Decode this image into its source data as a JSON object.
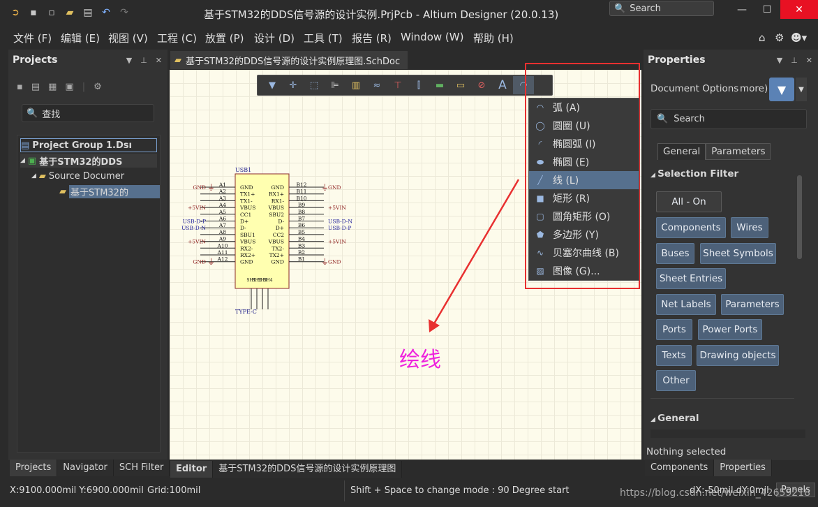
{
  "app": {
    "title": "基于STM32的DDS信号源的设计实例.PrjPcb - Altium Designer (20.0.13)",
    "search_label": "Search"
  },
  "menu": [
    "文件 (F)",
    "编辑 (E)",
    "视图 (V)",
    "工程 (C)",
    "放置 (P)",
    "设计 (D)",
    "工具 (T)",
    "报告 (R)",
    "Window (W)",
    "帮助 (H)"
  ],
  "projects_panel": {
    "title": "Projects",
    "search_placeholder": "查找",
    "tree": {
      "group": "Project Group 1.Dsı",
      "project": "基于STM32的DDS",
      "folder": "Source Documer",
      "doc": "基于STM32的"
    },
    "tabs": [
      "Projects",
      "Navigator",
      "SCH Filter"
    ]
  },
  "document": {
    "tab_label": "基于STM32的DDS信号源的设计实例原理图.SchDoc",
    "bottom_tabs": [
      "Editor",
      "基于STM32的DDS信号源的设计实例原理图"
    ]
  },
  "schematic": {
    "designator": "USB1",
    "footprint": "TYPE-C",
    "left_nets": [
      "GND",
      "+5VIN",
      "USB-D-P",
      "USB-D-N",
      "+5VIN",
      "GND"
    ],
    "left_pins": [
      "A1",
      "A2",
      "A3",
      "A4",
      "A5",
      "A6",
      "A7",
      "A8",
      "A9",
      "A10",
      "A11",
      "A12"
    ],
    "left_names": [
      "GND",
      "TX1+",
      "TX1-",
      "VBUS",
      "CC1",
      "D+",
      "D-",
      "SBU1",
      "VBUS",
      "RX2-",
      "RX2+",
      "GND"
    ],
    "right_pins": [
      "B12",
      "B11",
      "B10",
      "B9",
      "B8",
      "B7",
      "B6",
      "B5",
      "B4",
      "B3",
      "B2",
      "B1"
    ],
    "right_names": [
      "GND",
      "RX1+",
      "RX1-",
      "VBUS",
      "SBU2",
      "D-",
      "D+",
      "CC2",
      "VBUS",
      "TX2-",
      "TX2+",
      "GND"
    ],
    "right_nets": [
      "GND",
      "+5VIN",
      "USB-D-N",
      "USB-D-P",
      "+5VIN",
      "GND"
    ],
    "bottom_names": [
      "SH1",
      "SH2",
      "SH3",
      "SH4"
    ]
  },
  "dropdown": {
    "items": [
      {
        "label": "弧 (A)",
        "icon": "arc-icon"
      },
      {
        "label": "圆圈 (U)",
        "icon": "circle-icon"
      },
      {
        "label": "椭圆弧 (I)",
        "icon": "elliptical-arc-icon"
      },
      {
        "label": "椭圆 (E)",
        "icon": "ellipse-icon"
      },
      {
        "label": "线 (L)",
        "icon": "line-icon"
      },
      {
        "label": "矩形 (R)",
        "icon": "rectangle-icon"
      },
      {
        "label": "圆角矩形 (O)",
        "icon": "round-rectangle-icon"
      },
      {
        "label": "多边形 (Y)",
        "icon": "polygon-icon"
      },
      {
        "label": "贝塞尔曲线 (B)",
        "icon": "bezier-icon"
      },
      {
        "label": "图像 (G)...",
        "icon": "image-icon"
      }
    ],
    "selected_index": 4
  },
  "annotation": "绘线",
  "properties_panel": {
    "title": "Properties",
    "doc_options": "Document Options",
    "doc_options_more": "more)",
    "search_placeholder": "Search",
    "tabs": [
      "General",
      "Parameters"
    ],
    "selection_filter_title": "Selection Filter",
    "filter_buttons": [
      "All - On",
      "Components",
      "Wires",
      "Buses",
      "Sheet Symbols",
      "Sheet Entries",
      "Net Labels",
      "Parameters",
      "Ports",
      "Power Ports",
      "Texts",
      "Drawing objects",
      "Other"
    ],
    "general_title": "General",
    "nothing_selected": "Nothing selected",
    "bottom_tabs": [
      "Components",
      "Properties"
    ]
  },
  "status_bar": {
    "coords": "X:9100.000mil Y:6900.000mil",
    "grid": "Grid:100mil",
    "mode": "Shift + Space to change mode : 90 Degree start",
    "delta": "dX:-50mil dY:0mil",
    "panels": "Panels",
    "watermark": "https://blog.csdn.net/weixin_42659218"
  },
  "colors": {
    "accent": "#4d6179",
    "selected_menu": "#56708e",
    "highlight_box": "#e83030",
    "annotation": "#ee22dd",
    "component_fill": "#ffffb0"
  }
}
